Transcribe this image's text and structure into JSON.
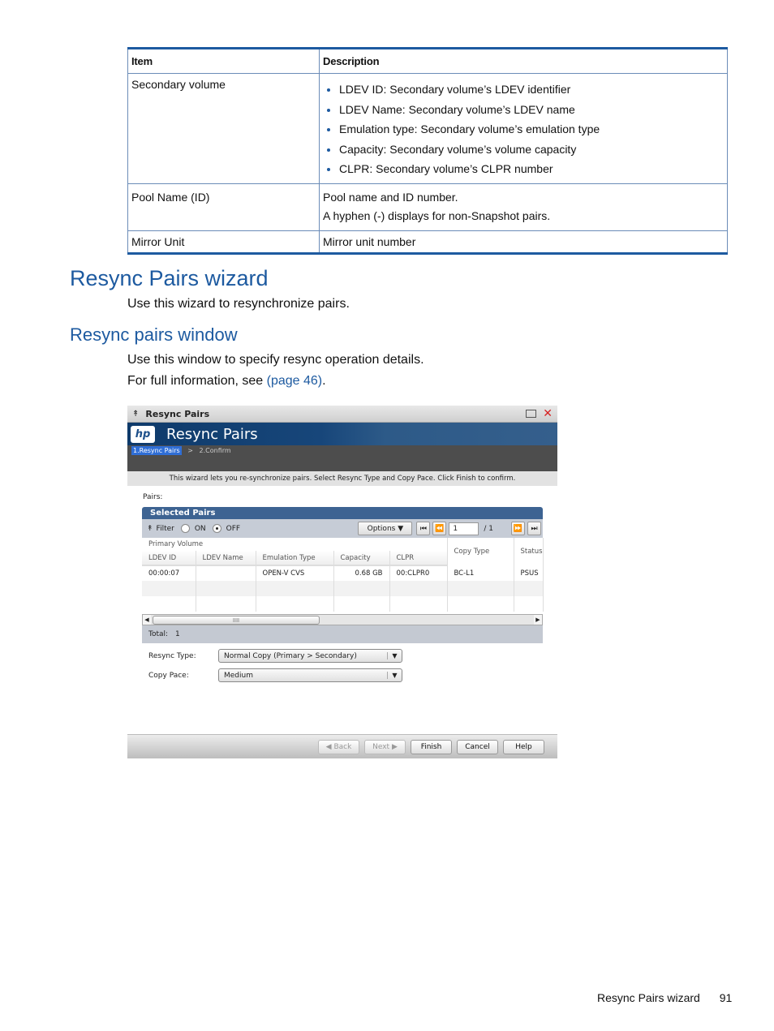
{
  "doc_table": {
    "headers": [
      "Item",
      "Description"
    ],
    "rows": [
      {
        "item": "Secondary volume",
        "bullets": [
          "LDEV ID: Secondary volume’s LDEV identifier",
          "LDEV Name: Secondary volume’s LDEV name",
          "Emulation type: Secondary volume’s emulation type",
          "Capacity: Secondary volume’s volume capacity",
          "CLPR: Secondary volume’s CLPR number"
        ]
      },
      {
        "item": "Pool Name (ID)",
        "lines": [
          "Pool name and ID number.",
          "A hyphen (-) displays for non-Snapshot pairs."
        ]
      },
      {
        "item": "Mirror Unit",
        "lines": [
          "Mirror unit number"
        ]
      }
    ]
  },
  "section": {
    "heading": "Resync Pairs wizard",
    "intro": "Use this wizard to resynchronize pairs.",
    "subheading": "Resync pairs window",
    "subintro": "Use this window to specify resync operation details.",
    "more_prefix": "For full information, see ",
    "more_link": "(page 46)",
    "more_suffix": "."
  },
  "window": {
    "title": "Resync Pairs",
    "banner_title": "Resync Pairs",
    "logo": "hp",
    "steps": [
      {
        "label": "1.Resync Pairs",
        "active": true
      },
      {
        "label": "2.Confirm",
        "active": false
      }
    ],
    "step_separator": ">",
    "instruction": "This wizard lets you re-synchronize pairs. Select Resync Type and Copy Pace. Click Finish to confirm.",
    "pairs_label": "Pairs:",
    "panel_title": "Selected Pairs",
    "filter_label": "Filter",
    "filter_on": "ON",
    "filter_off": "OFF",
    "filter_selected": "OFF",
    "options_label": "Options",
    "page_current": "1",
    "page_total": "/ 1",
    "group_header": "Primary Volume",
    "columns": [
      "LDEV ID",
      "LDEV Name",
      "Emulation Type",
      "Capacity",
      "CLPR",
      "Copy Type",
      "Status"
    ],
    "rows": [
      [
        "00:00:07",
        "",
        "OPEN-V CVS",
        "0.68 GB",
        "00:CLPR0",
        "BC-L1",
        "PSUS"
      ]
    ],
    "scroll_grip": "IIII",
    "total_label": "Total:",
    "total_value": "1",
    "resync_type_label": "Resync Type:",
    "resync_type_value": "Normal Copy (Primary > Secondary)",
    "copy_pace_label": "Copy Pace:",
    "copy_pace_value": "Medium",
    "buttons": {
      "back": "Back",
      "next": "Next",
      "finish": "Finish",
      "cancel": "Cancel",
      "help": "Help"
    }
  },
  "footer": {
    "section": "Resync Pairs wizard",
    "page": "91"
  }
}
